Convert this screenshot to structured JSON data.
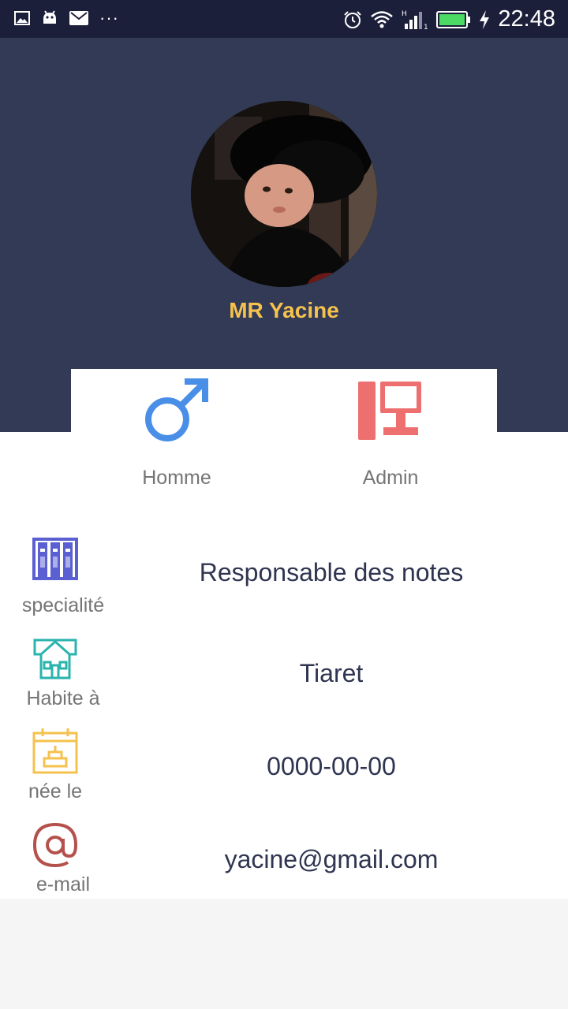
{
  "status_bar": {
    "time": "22:48",
    "left_icons": [
      "gallery-icon",
      "android-icon",
      "mail-icon",
      "more-dots-icon"
    ],
    "right_icons": [
      "alarm-icon",
      "wifi-icon",
      "signal-icon",
      "battery-icon",
      "charging-icon"
    ]
  },
  "profile": {
    "name": "MR Yacine",
    "colors": {
      "header_bg": "#323a55",
      "name": "#f6c24e"
    }
  },
  "tags": [
    {
      "icon": "male-gender-icon",
      "label": "Homme",
      "color": "#4a8fe7"
    },
    {
      "icon": "admin-computer-icon",
      "label": "Admin",
      "color": "#ee6f6f"
    }
  ],
  "info": [
    {
      "icon": "bookshelf-icon",
      "label": "specialité",
      "value": "Responsable des notes",
      "color": "#5a5fd1"
    },
    {
      "icon": "house-icon",
      "label": "Habite à",
      "value": "Tiaret",
      "color": "#2bb3ad"
    },
    {
      "icon": "birthday-calendar-icon",
      "label": "née le",
      "value": "0000-00-00",
      "color": "#f6c24e"
    },
    {
      "icon": "at-sign-icon",
      "label": "e-mail",
      "value": "yacine@gmail.com",
      "color": "#b5514c"
    }
  ]
}
